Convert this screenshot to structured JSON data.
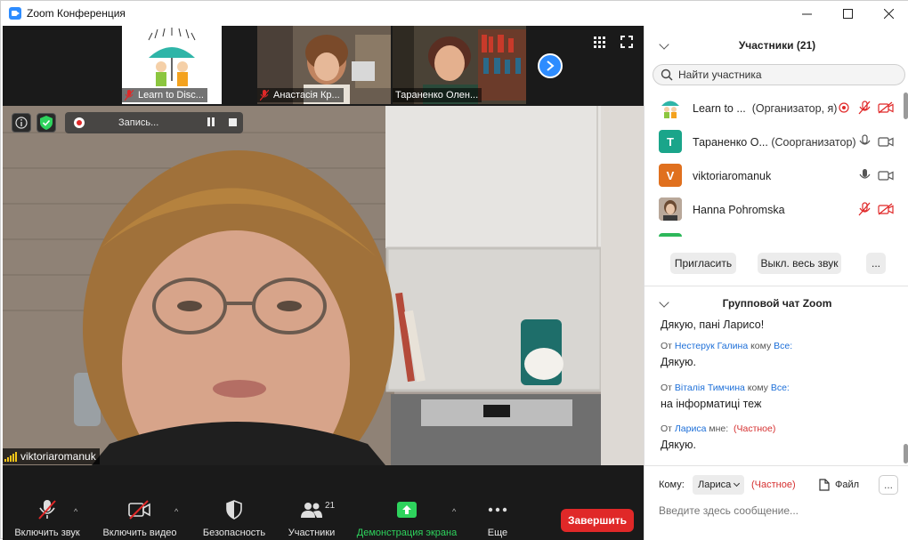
{
  "window": {
    "title": "Zoom Конференция",
    "minimize_icon": "minimize-icon",
    "maximize_icon": "maximize-icon",
    "close_icon": "close-icon"
  },
  "video_strip": {
    "thumbnails": [
      {
        "label": "Learn to Disc...",
        "muted": true
      },
      {
        "label": "Анастасія Кр...",
        "muted": true
      },
      {
        "label": "Тараненко Олен...",
        "muted": false
      }
    ],
    "next_icon": "chevron-right-icon",
    "gallery_icon": "grid-icon",
    "fullscreen_icon": "fullscreen-icon"
  },
  "main_video": {
    "recording_label": "Запись...",
    "speaker_name": "viktoriaromanuk"
  },
  "toolbar": {
    "items": [
      {
        "label": "Включить звук",
        "icon": "microphone-muted-icon"
      },
      {
        "label": "Включить видео",
        "icon": "video-off-icon"
      },
      {
        "label": "Безопасность",
        "icon": "shield-icon"
      },
      {
        "label": "Участники",
        "icon": "participants-icon",
        "count": "21"
      },
      {
        "label": "Демонстрация экрана",
        "icon": "share-screen-icon"
      },
      {
        "label": "Еще",
        "icon": "more-dots-icon"
      }
    ],
    "end_label": "Завершить"
  },
  "participants": {
    "header": "Участники (21)",
    "search_placeholder": "Найти участника",
    "list": [
      {
        "name": "Learn to ...",
        "role": "(Организатор, я)",
        "avatar_bg": "#ffffff"
      },
      {
        "name": "Тараненко О...",
        "role": "(Соорганизатор)",
        "avatar_letter": "T",
        "avatar_bg": "#1aa58a"
      },
      {
        "name": "viktoriaromanuk",
        "role": "",
        "avatar_letter": "V",
        "avatar_bg": "#e0701e"
      },
      {
        "name": "Hanna Pohromska",
        "role": "",
        "avatar_bg": "#8a7a70"
      }
    ],
    "invite_label": "Пригласить",
    "mute_all_label": "Выкл. весь звук",
    "more_label": "..."
  },
  "chat": {
    "header": "Групповой чат Zoom",
    "partial_top_text": "Дякую, пані Ларисо!",
    "messages": [
      {
        "from_prefix": "От",
        "sender": "Нестерук Галина",
        "to_prefix": "кому",
        "recipient": "Все:",
        "text": "Дякую."
      },
      {
        "from_prefix": "От",
        "sender": "Віталія Тимчина",
        "to_prefix": "кому",
        "recipient": "Все:",
        "text": "на інформатиці теж"
      },
      {
        "from_prefix": "От",
        "sender": "Лариса",
        "to_prefix": "мне:",
        "recipient": "(Частное)",
        "text": "Дякую."
      }
    ],
    "to_label": "Кому:",
    "to_value": "Лариса",
    "to_private": "(Частное)",
    "file_label": "Файл",
    "more_label": "...",
    "input_placeholder": "Введите здесь сообщение..."
  },
  "colors": {
    "accent_blue": "#2d8cff",
    "end_red": "#e02828",
    "share_green": "#2ed35d",
    "muted_red": "#e02828"
  }
}
